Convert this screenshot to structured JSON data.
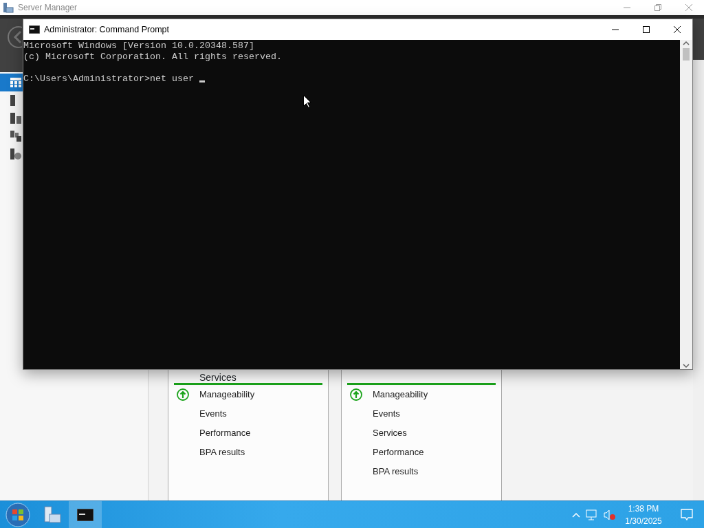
{
  "background_window": {
    "title": "Server Manager",
    "tiles": [
      {
        "heading": "Services",
        "items": [
          {
            "kind": "status",
            "label": "Manageability"
          },
          {
            "kind": "plain",
            "label": "Events"
          },
          {
            "kind": "plain",
            "label": "Performance"
          },
          {
            "kind": "plain",
            "label": "BPA results"
          }
        ]
      },
      {
        "items": [
          {
            "kind": "status",
            "label": "Manageability"
          },
          {
            "kind": "plain",
            "label": "Events"
          },
          {
            "kind": "plain",
            "label": "Services"
          },
          {
            "kind": "plain",
            "label": "Performance"
          },
          {
            "kind": "plain",
            "label": "BPA results"
          }
        ]
      }
    ]
  },
  "console_window": {
    "title": "Administrator: Command Prompt",
    "output": [
      "Microsoft Windows [Version 10.0.20348.587]",
      "(c) Microsoft Corporation. All rights reserved."
    ],
    "prompt": "C:\\Users\\Administrator>",
    "command": "net user "
  },
  "taskbar": {
    "apps": [
      {
        "kind": "server",
        "selected": false
      },
      {
        "kind": "console",
        "selected": true
      }
    ],
    "clock": {
      "time": "1:38 PM",
      "date": "1/30/2025"
    }
  }
}
